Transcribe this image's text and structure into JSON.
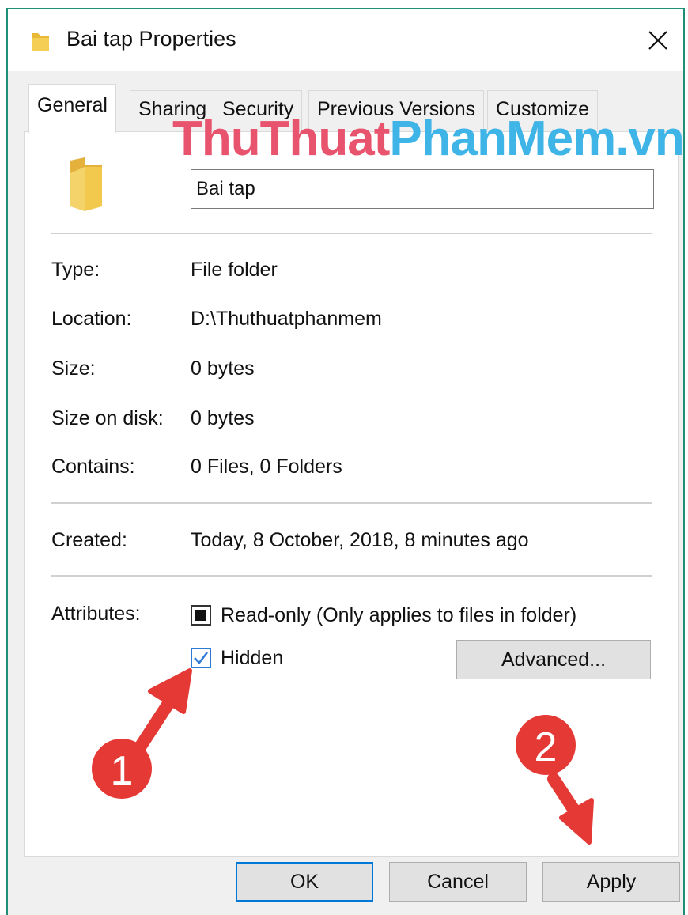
{
  "window": {
    "title": "Bai tap Properties",
    "accent_color": "#1f8f78"
  },
  "tabs": [
    {
      "label": "General",
      "active": true
    },
    {
      "label": "Sharing",
      "active": false
    },
    {
      "label": "Security",
      "active": false
    },
    {
      "label": "Previous Versions",
      "active": false
    },
    {
      "label": "Customize",
      "active": false
    }
  ],
  "watermark": {
    "part1": "ThuThuat",
    "part2": "PhanMem.vn"
  },
  "folder_name": "Bai tap",
  "properties": {
    "type_label": "Type:",
    "type_value": "File folder",
    "location_label": "Location:",
    "location_value": "D:\\Thuthuatphanmem",
    "size_label": "Size:",
    "size_value": "0 bytes",
    "size_on_disk_label": "Size on disk:",
    "size_on_disk_value": "0 bytes",
    "contains_label": "Contains:",
    "contains_value": "0 Files, 0 Folders",
    "created_label": "Created:",
    "created_value": "Today, 8 October, 2018, 8 minutes ago"
  },
  "attributes": {
    "label": "Attributes:",
    "readonly_label": "Read-only (Only applies to files in folder)",
    "readonly_state": "indeterminate",
    "hidden_label": "Hidden",
    "hidden_state": "checked",
    "advanced_button": "Advanced..."
  },
  "buttons": {
    "ok": "OK",
    "cancel": "Cancel",
    "apply": "Apply"
  },
  "annotations": {
    "step1": "1",
    "step2": "2",
    "color": "#e53935"
  }
}
